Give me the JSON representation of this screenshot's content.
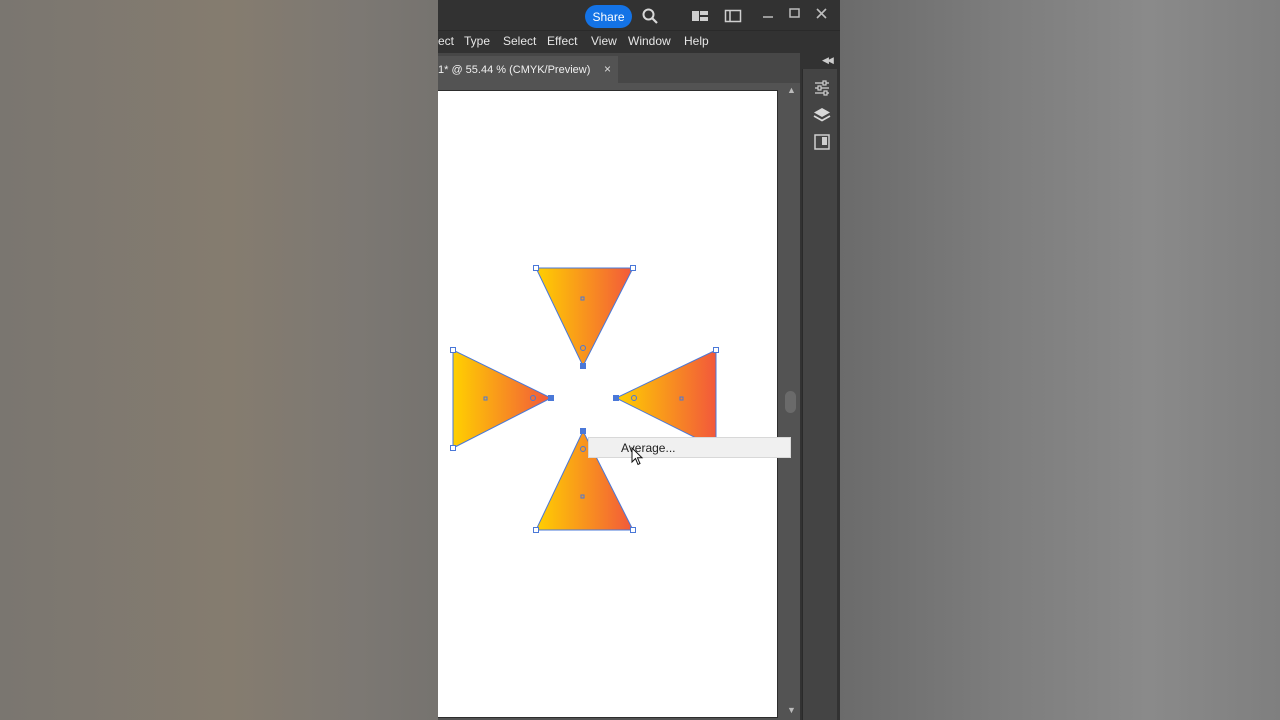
{
  "titlebar": {
    "share_label": "Share",
    "icons": [
      "search-icon",
      "arrange-documents-icon",
      "workspace-switcher-icon",
      "minimize-icon",
      "maximize-icon",
      "close-icon"
    ]
  },
  "menubar": {
    "items": [
      "ect",
      "Type",
      "Select",
      "Effect",
      "View",
      "Window",
      "Help"
    ]
  },
  "document_tab": {
    "label": "1* @ 55.44 % (CMYK/Preview)",
    "close_glyph": "×"
  },
  "right_panel": {
    "icons": [
      "properties-icon",
      "layers-icon",
      "libraries-icon"
    ]
  },
  "context_menu": {
    "items": [
      "Average..."
    ]
  },
  "colors": {
    "share_blue": "#1473e6",
    "gradient_start": "#ffd000",
    "gradient_end": "#f2583b",
    "selection_blue": "#4a78d8"
  }
}
